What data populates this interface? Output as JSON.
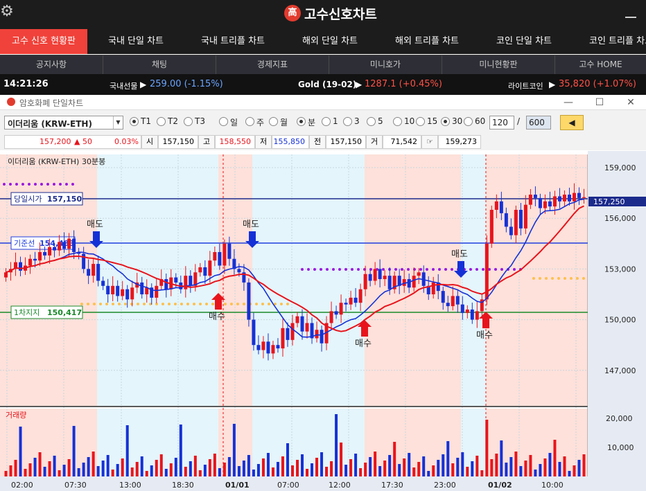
{
  "header": {
    "brand": "고수신호차트",
    "brand_logo": "高",
    "gear_icon": "gear-icon"
  },
  "main_tabs": [
    {
      "label": "고수 신호 현황판",
      "active": true
    },
    {
      "label": "국내 단일 차트"
    },
    {
      "label": "국내 트리플 차트"
    },
    {
      "label": "해외 단일 차트"
    },
    {
      "label": "해외 트리플 차트"
    },
    {
      "label": "코인 단일 차트"
    },
    {
      "label": "코인 트리플 차트"
    }
  ],
  "sub_tabs": [
    "공지사항",
    "채팅",
    "경제지표",
    "미니호가",
    "미니현황판",
    "고수 HOME"
  ],
  "ticker": {
    "time": "14:21:26",
    "items": [
      {
        "name": "국내선물",
        "arrow": "▶",
        "value": "259.00 (-1.15%)",
        "color": "#6aa5ff"
      },
      {
        "name": "Gold (19-02)",
        "arrow": "▶",
        "value": "1287.1 (+0.45%)",
        "color": "#ff5147"
      },
      {
        "name": "라이트코인",
        "arrow": "▶",
        "value": "35,820 (+1.07%)",
        "color": "#ff5147"
      }
    ]
  },
  "window": {
    "title": "암호화폐 단일차트",
    "minimize": "—",
    "maximize": "☐",
    "close": "✕"
  },
  "toolbar": {
    "symbol": "이더리움 (KRW-ETH)",
    "radios": [
      {
        "label": "T1",
        "on": true
      },
      {
        "label": "T2"
      },
      {
        "label": "T3"
      },
      {
        "label": "일"
      },
      {
        "label": "주"
      },
      {
        "label": "월"
      },
      {
        "label": "분",
        "on": true
      },
      {
        "label": "1"
      },
      {
        "label": "3"
      },
      {
        "label": "5"
      },
      {
        "label": "10"
      },
      {
        "label": "15"
      },
      {
        "label": "30",
        "on": true
      },
      {
        "label": "60"
      }
    ],
    "count": "120",
    "slash": "/",
    "total": "600",
    "back_button": "◀"
  },
  "quote": {
    "price": "157,200",
    "change": "▲ 50",
    "pct": "0.03%",
    "open_label": "시",
    "open": "157,150",
    "high_label": "고",
    "high": "158,550",
    "low_label": "저",
    "low": "155,850",
    "prev_label": "전",
    "prev": "157,150",
    "vol_label": "거",
    "vol": "71,542",
    "amt_icon": "☞",
    "amt": "159,273"
  },
  "chart_data": {
    "type": "candlestick",
    "title": "이더리움 (KRW-ETH)",
    "subtitle": "30분봉",
    "price_ylim": [
      145000,
      160000
    ],
    "price_ticks": [
      "159,000",
      "156,000",
      "153,000",
      "150,000",
      "147,000"
    ],
    "volume_ticks": [
      "20,000",
      "10,000"
    ],
    "volume_label": "거래량",
    "x_ticks": [
      "02:00",
      "07:30",
      "13:00",
      "18:30",
      "01/01",
      "07:00",
      "12:00",
      "17:30",
      "23:00",
      "01/02",
      "10:00"
    ],
    "current_price_label": "157,250",
    "levels": [
      {
        "name": "당일시가",
        "value": "157,150",
        "color": "#1b2b8c"
      },
      {
        "name": "기준선",
        "value": "154,483",
        "color": "#1f3fe0"
      },
      {
        "name": "1차지지",
        "value": "150,417",
        "color": "#1a8a2a"
      }
    ],
    "signals": [
      {
        "type": "sell",
        "label": "매도"
      },
      {
        "type": "buy",
        "label": "매수"
      },
      {
        "type": "sell",
        "label": "매도"
      },
      {
        "type": "buy",
        "label": "매수"
      },
      {
        "type": "sell",
        "label": "매도"
      },
      {
        "type": "buy",
        "label": "매수"
      }
    ],
    "colors": {
      "up": "#e8141c",
      "down": "#1531d6",
      "ma_red": "#e8141c",
      "ma_blue": "#1531d6",
      "zone_pink": "#fde1da",
      "zone_blue": "#e4f5fb"
    }
  }
}
